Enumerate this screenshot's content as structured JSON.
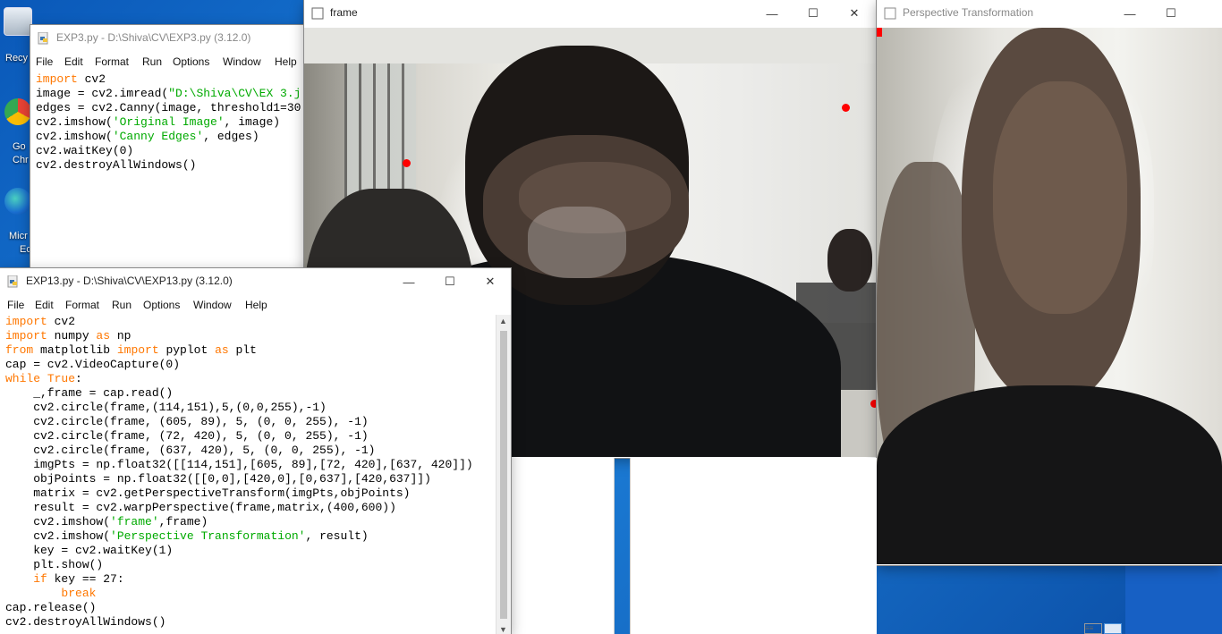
{
  "desktop": {
    "icons": [
      {
        "label": "Recy",
        "icon": "recycle-bin-icon"
      },
      {
        "label": "Go\nChr",
        "icon": "chrome-icon"
      },
      {
        "label": "Micr\nEd",
        "icon": "edge-icon"
      }
    ]
  },
  "exp3": {
    "title": "EXP3.py - D:\\Shiva\\CV\\EXP3.py (3.12.0)",
    "menu": [
      "File",
      "Edit",
      "Format",
      "Run",
      "Options",
      "Window",
      "Help"
    ],
    "code": [
      [
        {
          "t": "import",
          "c": "kw"
        },
        {
          "t": " cv2"
        }
      ],
      [
        {
          "t": "image = cv2.imread("
        },
        {
          "t": "\"D:\\Shiva\\CV\\EX 3.j",
          "c": "str"
        }
      ],
      [
        {
          "t": "edges = cv2.Canny(image, threshold1=30"
        }
      ],
      [
        {
          "t": "cv2.imshow("
        },
        {
          "t": "'Original Image'",
          "c": "str"
        },
        {
          "t": ", image)"
        }
      ],
      [
        {
          "t": "cv2.imshow("
        },
        {
          "t": "'Canny Edges'",
          "c": "str"
        },
        {
          "t": ", edges)"
        }
      ],
      [
        {
          "t": "cv2.waitKey(0)"
        }
      ],
      [
        {
          "t": "cv2.destroyAllWindows()"
        }
      ]
    ]
  },
  "frame_window": {
    "title": "frame"
  },
  "persp_window": {
    "title": "Perspective Transformation"
  },
  "exp13": {
    "title": "EXP13.py - D:\\Shiva\\CV\\EXP13.py (3.12.0)",
    "menu": [
      "File",
      "Edit",
      "Format",
      "Run",
      "Options",
      "Window",
      "Help"
    ],
    "code": [
      [
        {
          "t": "import",
          "c": "kw"
        },
        {
          "t": " cv2"
        }
      ],
      [
        {
          "t": "import",
          "c": "kw"
        },
        {
          "t": " numpy "
        },
        {
          "t": "as",
          "c": "kw"
        },
        {
          "t": " np"
        }
      ],
      [
        {
          "t": "from",
          "c": "kw"
        },
        {
          "t": " matplotlib "
        },
        {
          "t": "import",
          "c": "kw"
        },
        {
          "t": " pyplot "
        },
        {
          "t": "as",
          "c": "kw"
        },
        {
          "t": " plt"
        }
      ],
      [
        {
          "t": "cap = cv2.VideoCapture(0)"
        }
      ],
      [
        {
          "t": "while",
          "c": "kw"
        },
        {
          "t": " "
        },
        {
          "t": "True",
          "c": "kw"
        },
        {
          "t": ":"
        }
      ],
      [
        {
          "t": "    _,frame = cap.read()"
        }
      ],
      [
        {
          "t": "    cv2.circle(frame,(114,151),5,(0,0,255),-1)"
        }
      ],
      [
        {
          "t": "    cv2.circle(frame, (605, 89), 5, (0, 0, 255), -1)"
        }
      ],
      [
        {
          "t": "    cv2.circle(frame, (72, 420), 5, (0, 0, 255), -1)"
        }
      ],
      [
        {
          "t": "    cv2.circle(frame, (637, 420), 5, (0, 0, 255), -1)"
        }
      ],
      [
        {
          "t": "    imgPts = np.float32([[114,151],[605, 89],[72, 420],[637, 420]])"
        }
      ],
      [
        {
          "t": "    objPoints = np.float32([[0,0],[420,0],[0,637],[420,637]])"
        }
      ],
      [
        {
          "t": "    matrix = cv2.getPerspectiveTransform(imgPts,objPoints)"
        }
      ],
      [
        {
          "t": "    result = cv2.warpPerspective(frame,matrix,(400,600))"
        }
      ],
      [
        {
          "t": "    cv2.imshow("
        },
        {
          "t": "'frame'",
          "c": "str"
        },
        {
          "t": ",frame)"
        }
      ],
      [
        {
          "t": "    cv2.imshow("
        },
        {
          "t": "'Perspective Transformation'",
          "c": "str"
        },
        {
          "t": ", result)"
        }
      ],
      [
        {
          "t": "    key = cv2.waitKey(1)"
        }
      ],
      [
        {
          "t": "    plt.show()"
        }
      ],
      [
        {
          "t": "    "
        },
        {
          "t": "if",
          "c": "kw"
        },
        {
          "t": " key == 27:"
        }
      ],
      [
        {
          "t": "        "
        },
        {
          "t": "break",
          "c": "kw"
        }
      ],
      [
        {
          "t": "cap.release()"
        }
      ],
      [
        {
          "t": "cv2.destroyAllWindows()"
        }
      ]
    ]
  },
  "controls": {
    "minimize": "—",
    "maximize": "☐",
    "close": "✕"
  }
}
